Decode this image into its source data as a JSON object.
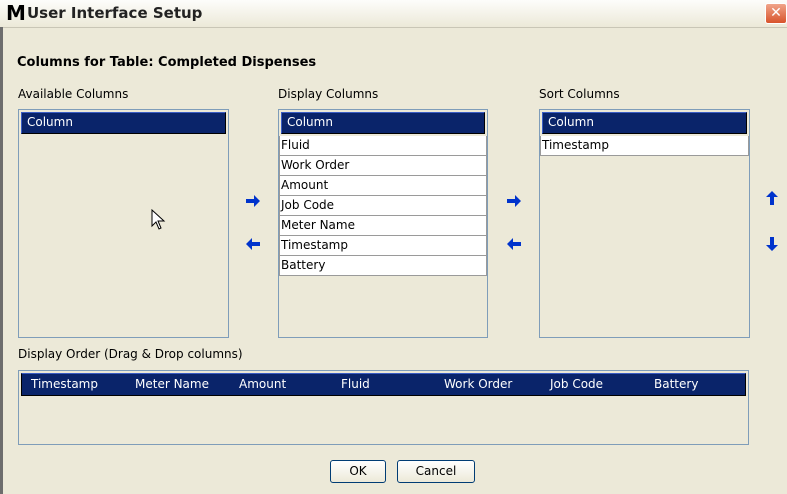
{
  "window": {
    "logo": "M",
    "title": "User Interface Setup",
    "close_glyph": "✕"
  },
  "heading": "Columns for Table: Completed Dispenses",
  "available": {
    "label": "Available Columns",
    "column_header": "Column",
    "rows": []
  },
  "display": {
    "label": "Display Columns",
    "column_header": "Column",
    "rows": [
      "Fluid",
      "Work Order",
      "Amount",
      "Job Code",
      "Meter Name",
      "Timestamp",
      "Battery"
    ]
  },
  "sort": {
    "label": "Sort Columns",
    "column_header": "Column",
    "rows": [
      "Timestamp"
    ]
  },
  "icons": {
    "add_to_display": "arrow-right-icon",
    "remove_from_display": "arrow-left-icon",
    "add_to_sort": "arrow-right-icon",
    "remove_from_sort": "arrow-left-icon",
    "move_up": "arrow-up-icon",
    "move_down": "arrow-down-icon",
    "arrow_color": "#0033cc"
  },
  "order": {
    "label": "Display Order (Drag & Drop columns)",
    "columns": [
      "Timestamp",
      "Meter Name",
      "Amount",
      "Fluid",
      "Work Order",
      "Job Code",
      "Battery"
    ]
  },
  "buttons": {
    "ok": "OK",
    "cancel": "Cancel"
  },
  "colors": {
    "selection": "#0a246a",
    "dialog_bg": "#ece9d8"
  }
}
